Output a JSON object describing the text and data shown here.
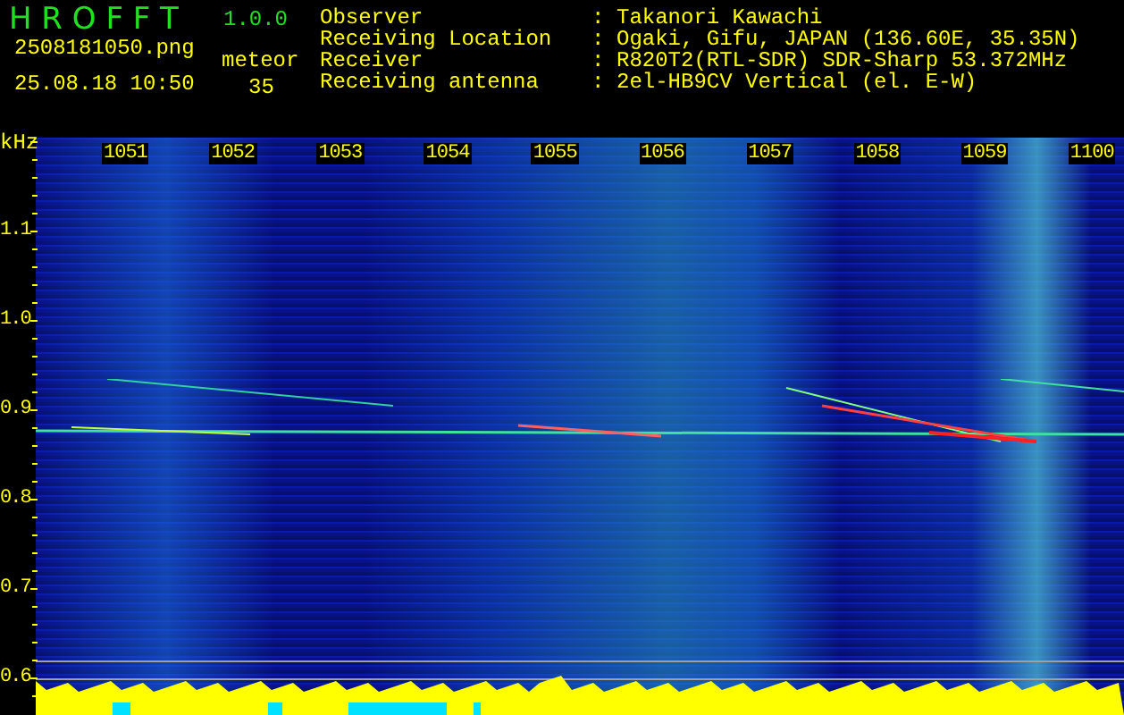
{
  "header": {
    "title": "H R O F F T",
    "version": "1.0.0",
    "filename": "2508181050.png",
    "datetime": "25.08.18 10:50",
    "meteor_label": "meteor",
    "meteor_count": "35"
  },
  "info": [
    {
      "label": "Observer",
      "separator": ":",
      "value": "Takanori Kawachi"
    },
    {
      "label": "Receiving Location",
      "separator": ":",
      "value": "Ogaki, Gifu, JAPAN (136.60E, 35.35N)"
    },
    {
      "label": "Receiver",
      "separator": ":",
      "value": "R820T2(RTL-SDR) SDR-Sharp 53.372MHz"
    },
    {
      "label": "Receiving antenna",
      "separator": ":",
      "value": "2el-HB9CV Vertical (el. E-W)"
    }
  ],
  "plot": {
    "y_unit": "kHz",
    "y_labels": [
      "1.1",
      "1.0",
      "0.9",
      "0.8",
      "0.7",
      "0.6"
    ],
    "x_labels": [
      "1051",
      "1052",
      "1053",
      "1054",
      "1055",
      "1056",
      "1057",
      "1058",
      "1059",
      "1100"
    ]
  }
}
